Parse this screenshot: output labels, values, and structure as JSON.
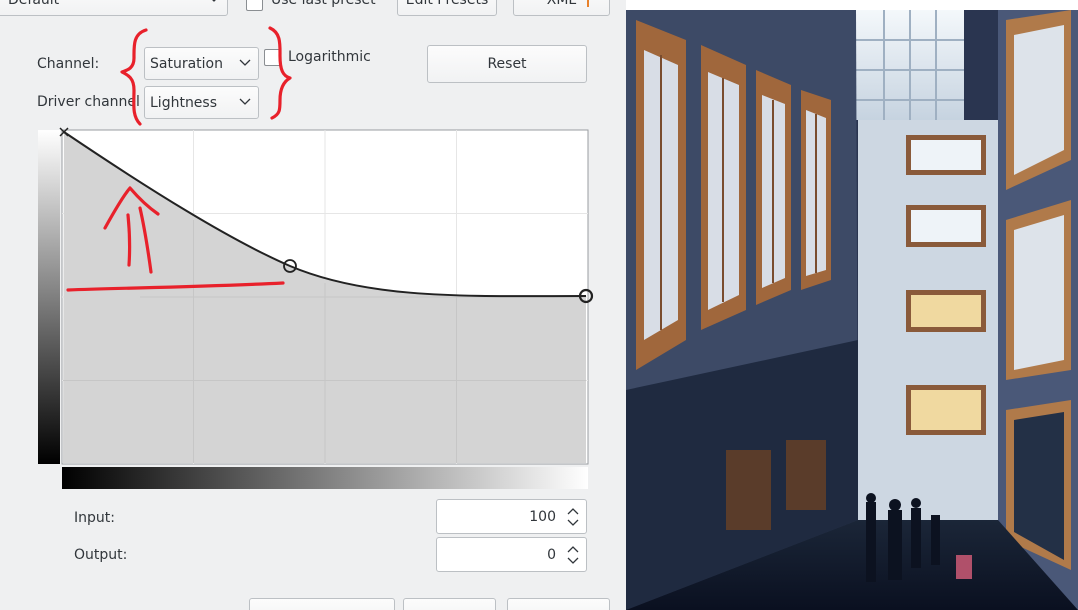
{
  "top": {
    "preset_value": "Default",
    "use_last_preset_label": "Use last preset",
    "edit_presets_label": "Edit Presets",
    "xml_label": "XML"
  },
  "controls": {
    "channel_label": "Channel:",
    "channel_value": "Saturation",
    "driver_channel_label": "Driver channel",
    "driver_channel_value": "Lightness",
    "logarithmic_label": "Logarithmic",
    "reset_label": "Reset"
  },
  "io": {
    "input_label": "Input:",
    "input_value": "100",
    "output_label": "Output:",
    "output_value": "0"
  },
  "colors": {
    "annotation": "#e8212b",
    "curve_fill": "#d4d4d4",
    "panel_bg": "#eff0f1"
  }
}
